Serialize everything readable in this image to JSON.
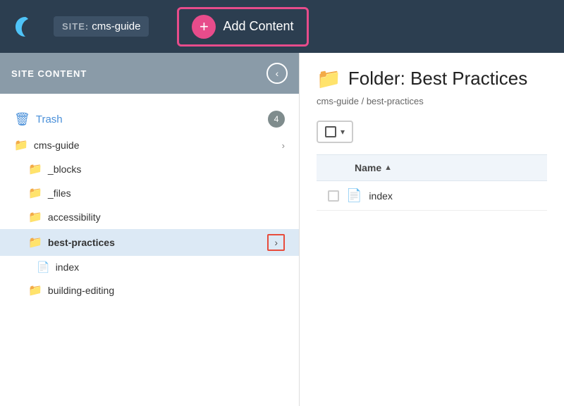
{
  "header": {
    "site_label": "SITE:",
    "site_name": "cms-guide",
    "add_content_label": "Add Content"
  },
  "sidebar": {
    "title": "SITE CONTENT",
    "trash": {
      "label": "Trash",
      "count": "4"
    },
    "items": [
      {
        "id": "cms-guide",
        "label": "cms-guide",
        "indent": 0,
        "type": "folder",
        "has_chevron": true
      },
      {
        "id": "_blocks",
        "label": "_blocks",
        "indent": 1,
        "type": "folder",
        "has_chevron": false
      },
      {
        "id": "_files",
        "label": "_files",
        "indent": 1,
        "type": "folder",
        "has_chevron": false
      },
      {
        "id": "accessibility",
        "label": "accessibility",
        "indent": 1,
        "type": "folder",
        "has_chevron": false
      },
      {
        "id": "best-practices",
        "label": "best-practices",
        "indent": 1,
        "type": "folder",
        "has_chevron": true,
        "active": true
      },
      {
        "id": "index",
        "label": "index",
        "indent": 2,
        "type": "file",
        "has_chevron": false
      },
      {
        "id": "building-editing",
        "label": "building-editing",
        "indent": 1,
        "type": "folder",
        "has_chevron": false
      }
    ]
  },
  "right_panel": {
    "folder_title": "Folder: Best Practices",
    "breadcrumb_site": "cms-guide",
    "breadcrumb_sep": " / ",
    "breadcrumb_path": "best-practices",
    "table": {
      "name_col": "Name",
      "rows": [
        {
          "name": "index",
          "type": "file"
        }
      ]
    }
  },
  "icons": {
    "logo": "☽",
    "trash": "🗑",
    "folder": "📁",
    "file": "📄",
    "plus": "+",
    "chevron_left": "‹",
    "chevron_right": "›",
    "sort_asc": "▲"
  }
}
